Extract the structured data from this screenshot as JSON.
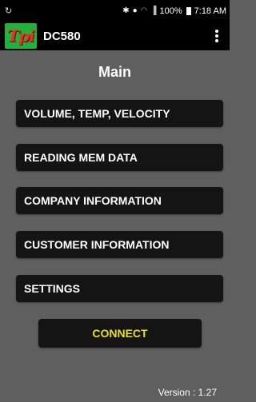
{
  "status_bar": {
    "left_icon": "sync-icon",
    "battery": "100%",
    "time": "7:18 AM"
  },
  "app_bar": {
    "logo_text": "Tpi",
    "title": "DC580"
  },
  "main": {
    "title": "Main",
    "buttons": [
      {
        "label": "VOLUME, TEMP, VELOCITY"
      },
      {
        "label": "READING MEM DATA"
      },
      {
        "label": "COMPANY INFORMATION"
      },
      {
        "label": "CUSTOMER INFORMATION"
      },
      {
        "label": "SETTINGS"
      }
    ],
    "connect_label": "CONNECT"
  },
  "footer": {
    "version": "Version : 1.27"
  },
  "colors": {
    "background": "#5f5f5f",
    "button_bg": "#141414",
    "connect_text": "#e8e01a",
    "logo_green": "#1fb33b",
    "logo_red": "#ff2a1a"
  }
}
